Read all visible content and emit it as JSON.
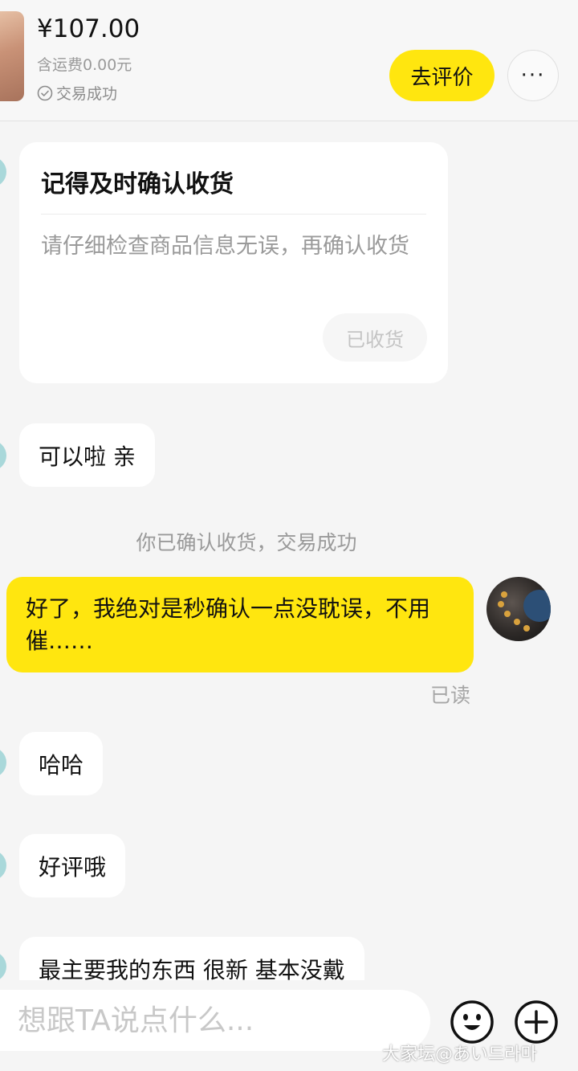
{
  "header": {
    "price": "¥107.00",
    "shipping": "含运费0.00元",
    "status": "交易成功",
    "review_button": "去评价",
    "more_button": "···"
  },
  "card": {
    "title": "记得及时确认收货",
    "body": "请仔细检查商品信息无误，再确认收货",
    "button": "已收货"
  },
  "messages": {
    "m1": "可以啦 亲",
    "system": "你已确认收货，交易成功",
    "mine": "好了，我绝对是秒确认一点没耽误，不用催……",
    "read_status": "已读",
    "m2": "哈哈",
    "m3": "好评哦",
    "m4": "最主要我的东西 很新 基本没戴"
  },
  "input": {
    "placeholder": "想跟TA说点什么..."
  },
  "icons": {
    "status": "check-circle-icon",
    "emoji": "emoji-icon",
    "add": "plus-circle-icon"
  },
  "watermark": "大家坛@あい드라마",
  "colors": {
    "accent": "#ffe60f",
    "background": "#f5f5f5"
  }
}
